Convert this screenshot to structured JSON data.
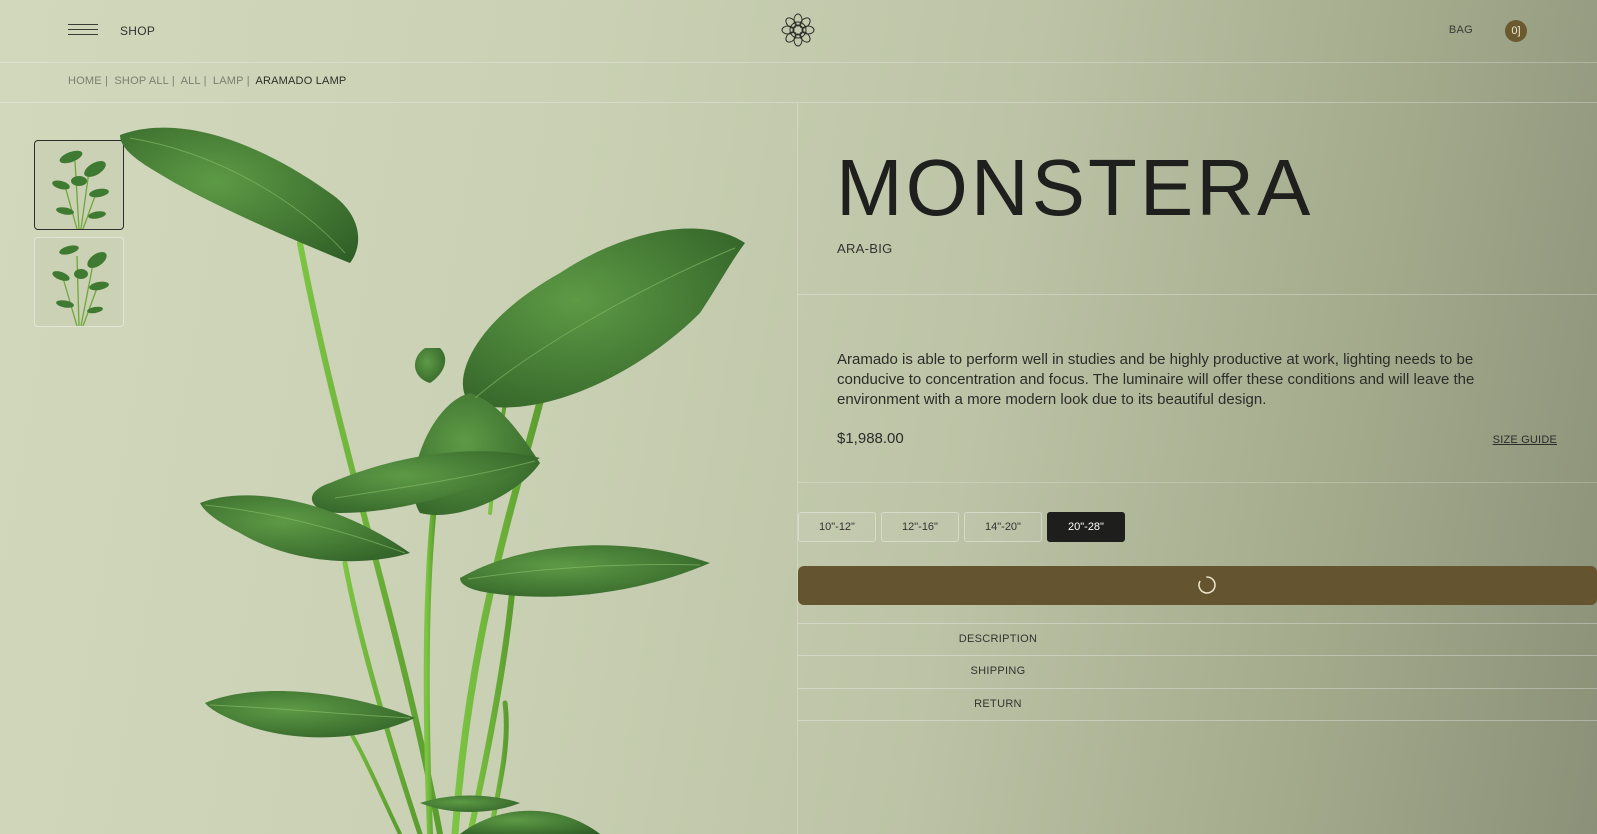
{
  "header": {
    "menu_icon": "hamburger-menu-icon",
    "shop_label": "SHOP",
    "logo_icon": "mandala-logo-icon",
    "bag_label": "BAG",
    "bag_count": "0]"
  },
  "breadcrumb": {
    "items": [
      "HOME |",
      "SHOP ALL |",
      "ALL |",
      "LAMP |"
    ],
    "current": "ARAMADO LAMP"
  },
  "gallery": {
    "thumbnails": [
      {
        "icon": "plant-thumbnail",
        "active": true
      },
      {
        "icon": "plant-thumbnail",
        "active": false
      }
    ],
    "main_image": "monstera-plant-image"
  },
  "product": {
    "title": "MONSTERA",
    "sku": "ARA-BIG",
    "description": "Aramado is able to perform well in studies and be highly productive at work, lighting needs to be conducive to concentration and focus. The luminaire will offer these conditions and will leave the environment with a more modern look due to its beautiful design.",
    "price": "$1,988.00",
    "size_guide_label": "SIZE GUIDE",
    "sizes": [
      "10\"-12\"",
      "12\"-16\"",
      "14\"-20\"",
      "20\"-28\""
    ],
    "selected_size": "20\"-28\"",
    "add_button_icon": "loading-spinner-icon"
  },
  "accordion": {
    "items": [
      "DESCRIPTION",
      "SHIPPING",
      "RETURN"
    ]
  },
  "colors": {
    "accent": "#645530",
    "badge": "#6b5a2f",
    "selected_size_bg": "#1e1e1c",
    "background": "#c9d0b3"
  }
}
